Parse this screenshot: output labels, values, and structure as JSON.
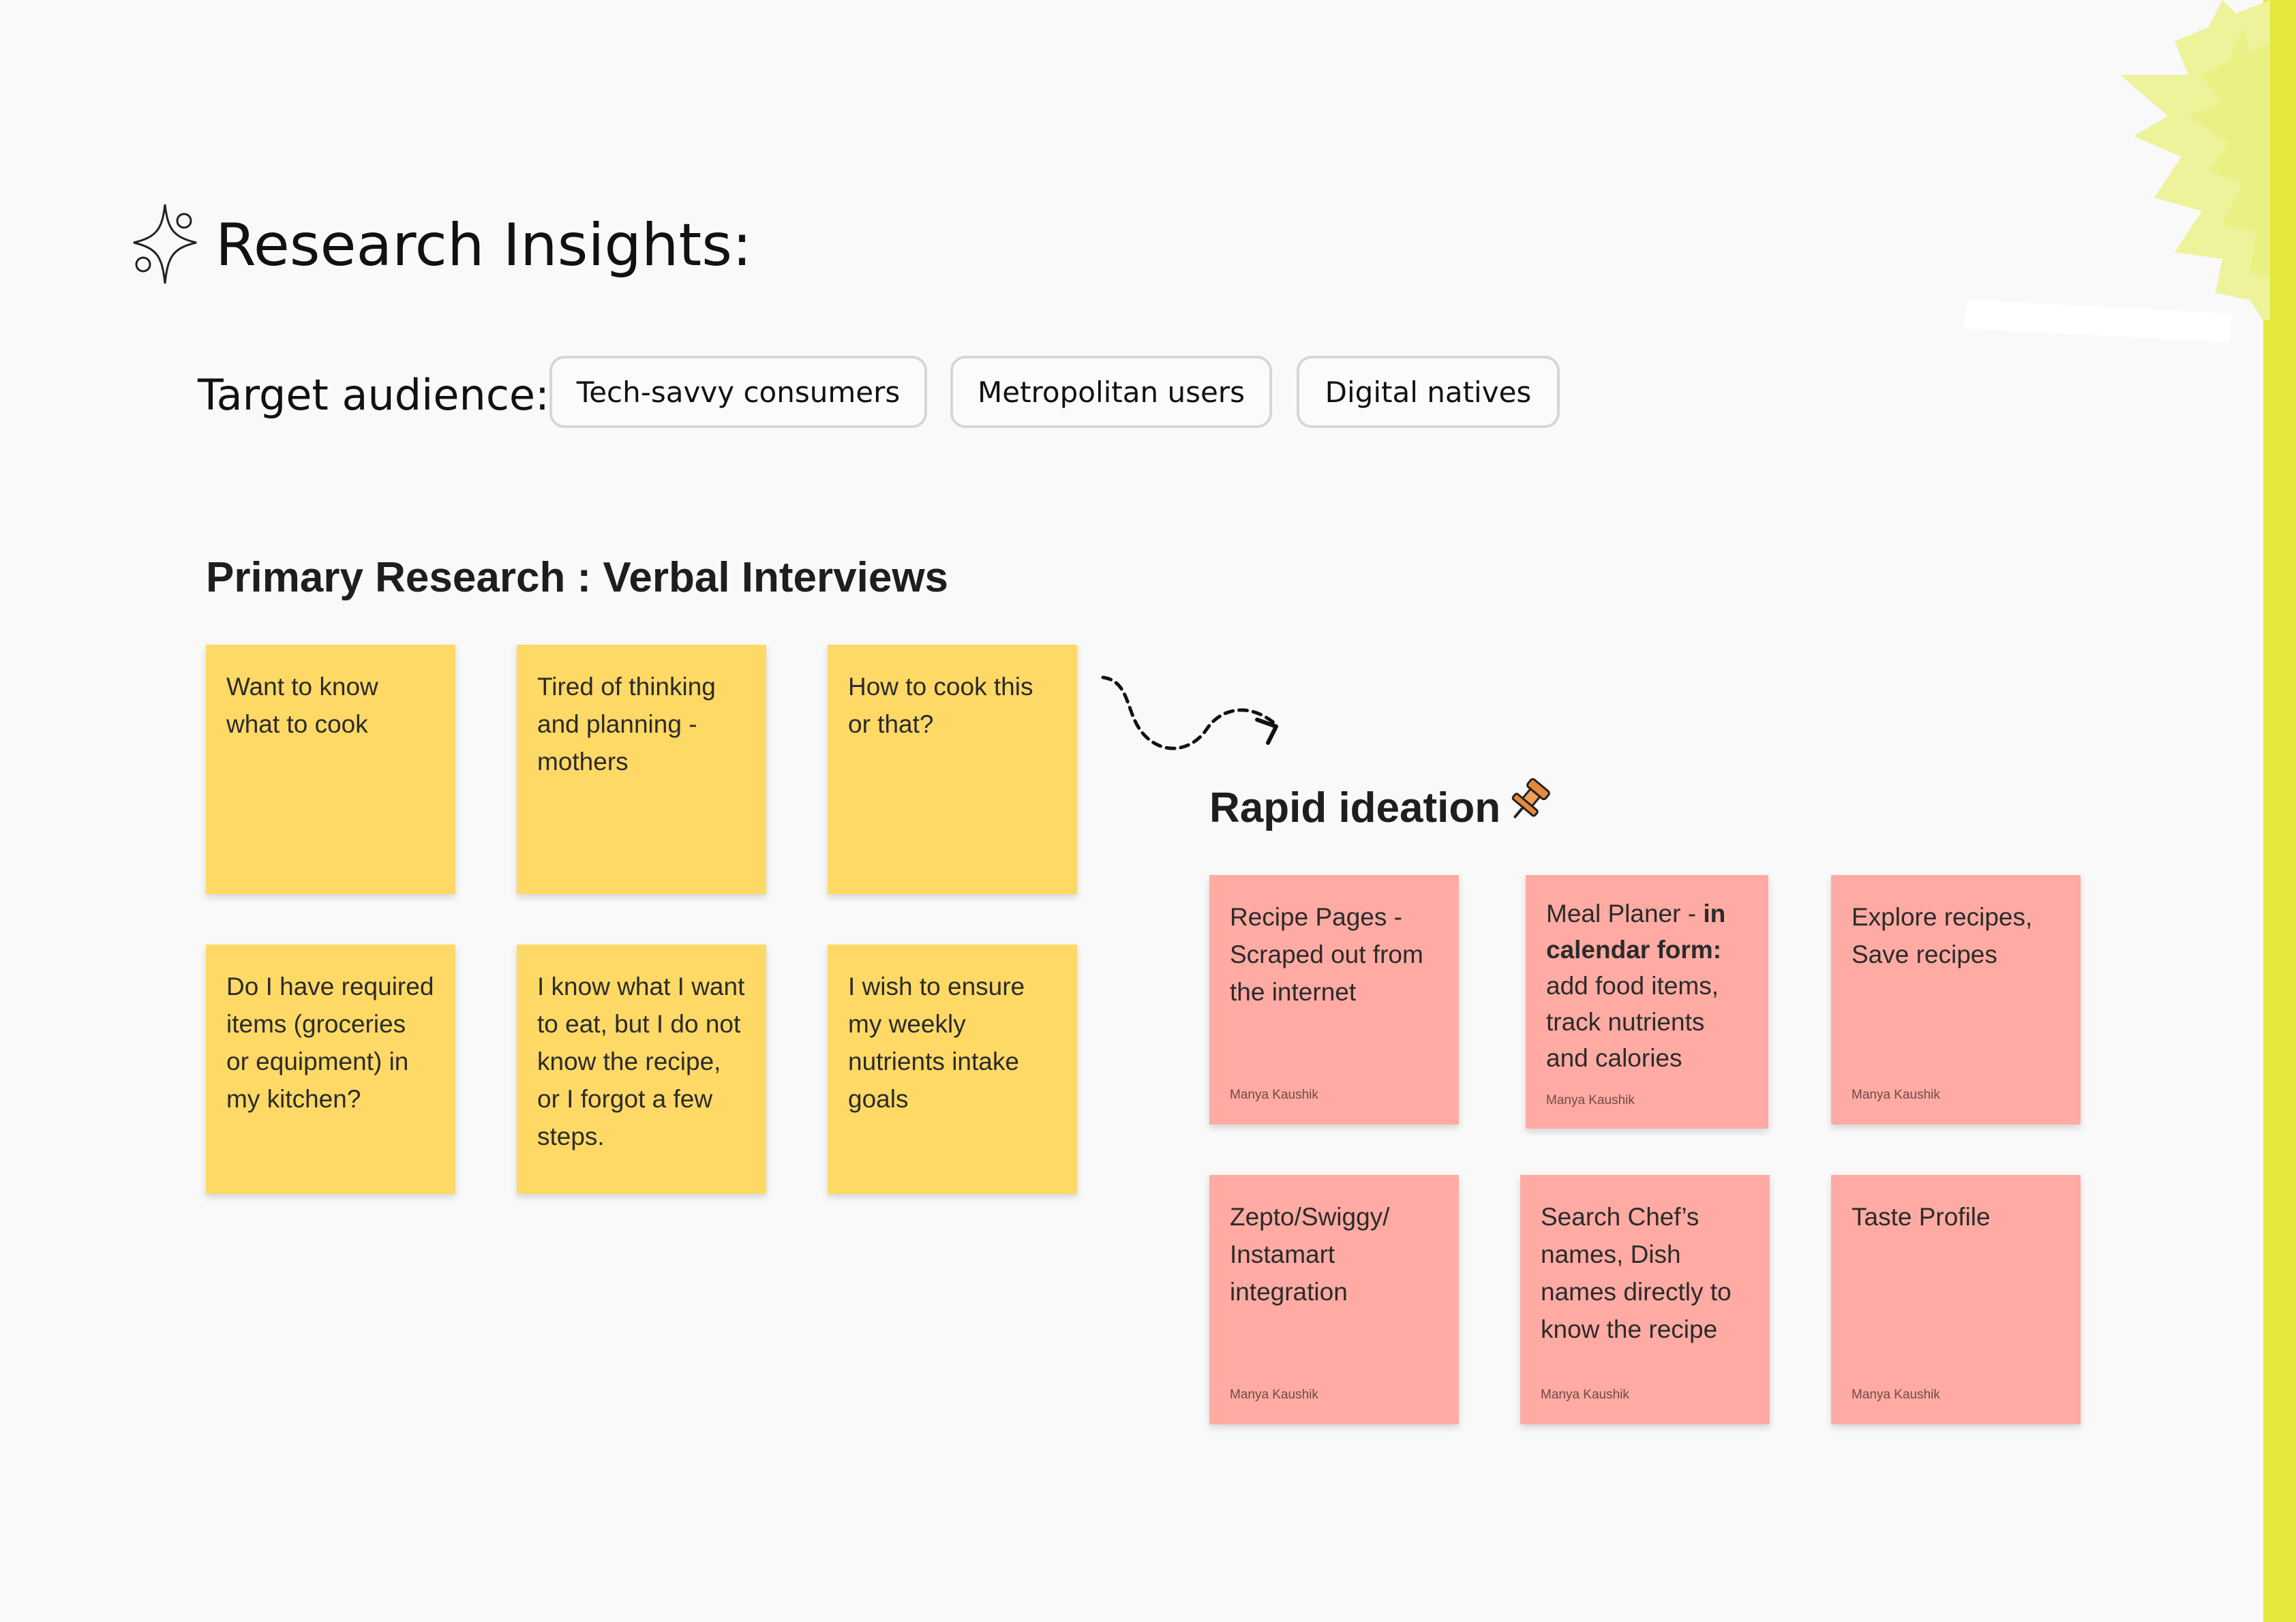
{
  "title": "Research Insights:",
  "audience": {
    "label": "Target audience:",
    "chips": [
      "Tech-savvy consumers",
      "Metropolitan users",
      "Digital natives"
    ]
  },
  "primary": {
    "heading": "Primary Research : Verbal Interviews",
    "notes": [
      "Want to know what to cook",
      "Tired of thinking and planning - mothers",
      "How to cook this or that?",
      "Do I have required items (groceries or equipment) in my kitchen?",
      "I know what I want to eat, but I do not know the recipe, or I forgot a few steps.",
      "I wish to ensure my weekly nutrients intake goals"
    ]
  },
  "ideation": {
    "heading": "Rapid ideation",
    "notes": [
      {
        "text": "Recipe Pages - Scraped out from the internet",
        "author": "Manya Kaushik"
      },
      {
        "text_before": "Meal Planer - ",
        "text_bold": "in calendar form:",
        "text_after": " add food items, track nutrients and calories",
        "author": "Manya Kaushik"
      },
      {
        "text": "Explore recipes, Save recipes",
        "author": "Manya Kaushik"
      },
      {
        "text": "Zepto/Swiggy/ Instamart integration",
        "author": "Manya Kaushik"
      },
      {
        "text": "Search Chef’s names, Dish names directly to know the recipe",
        "author": "Manya Kaushik"
      },
      {
        "text": "Taste Profile",
        "author": "Manya Kaushik"
      }
    ]
  },
  "colors": {
    "yellow_note": "#ffd966",
    "pink_note": "#ffaba3",
    "accent": "#e3e83a"
  },
  "icons": {
    "title": "sparkle-icon",
    "ideation": "pin-icon",
    "connector": "dashed-arrow-icon"
  }
}
